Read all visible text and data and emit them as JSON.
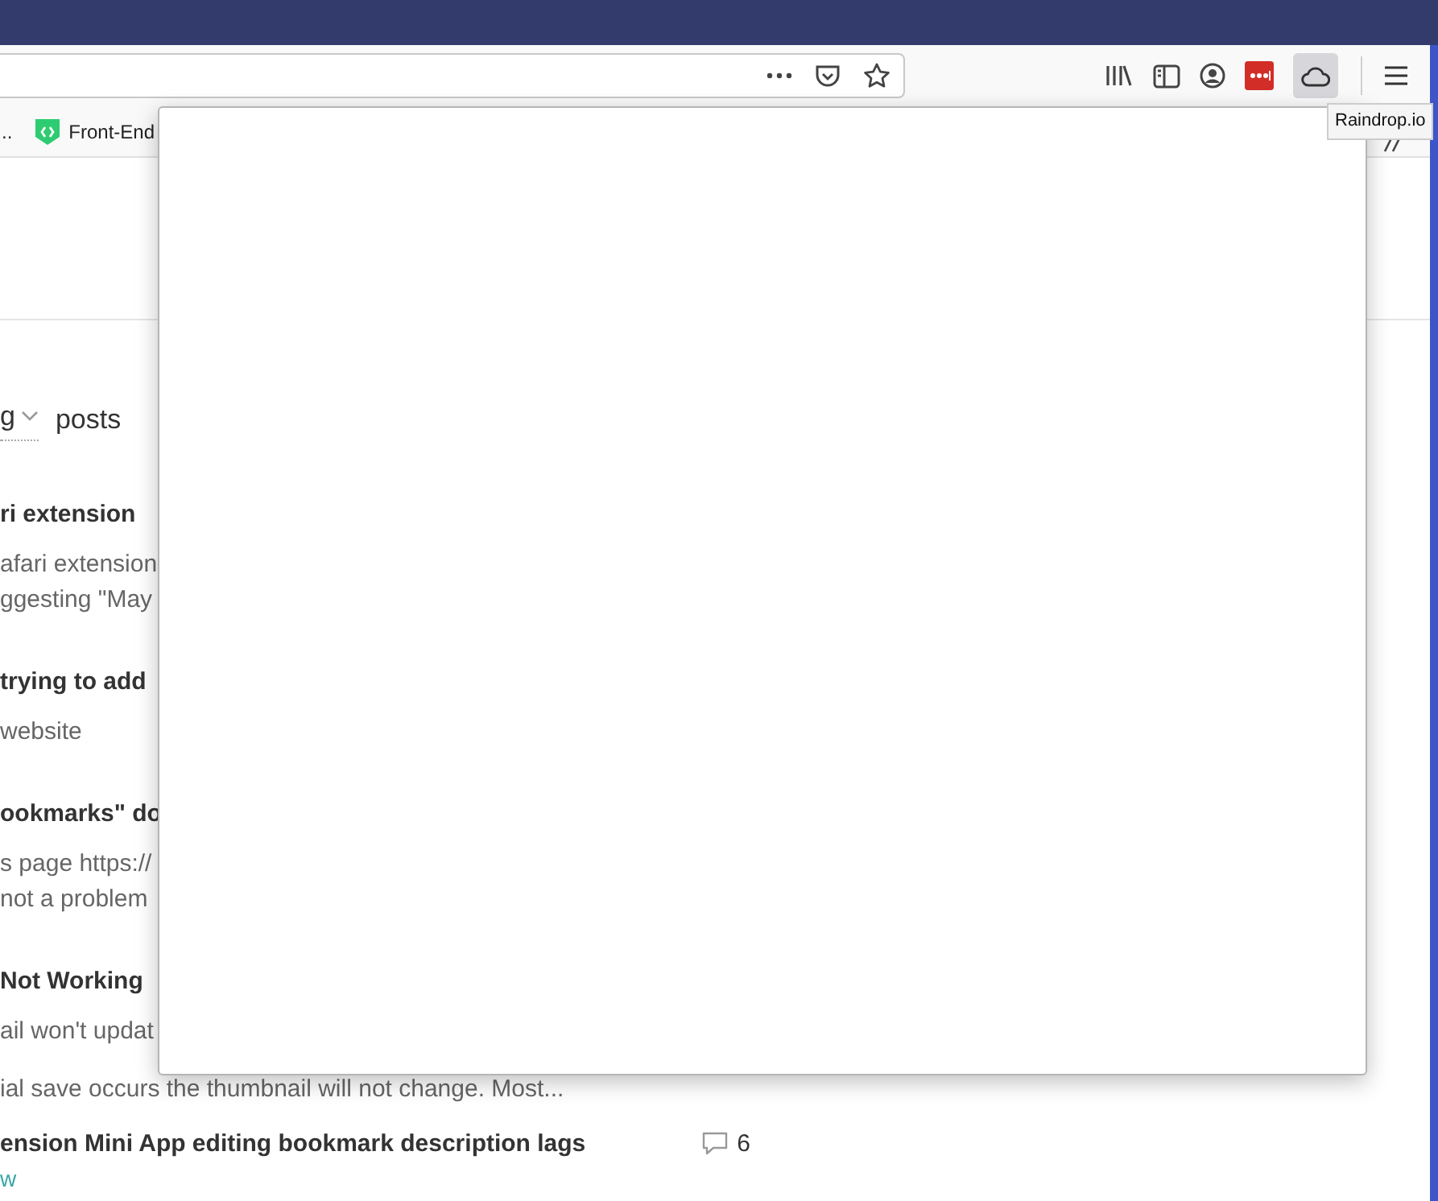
{
  "toolbar": {
    "raindrop_button": {
      "pressed": true
    },
    "tooltip": "Raindrop.io"
  },
  "bookmarks": [
    {
      "label": ".."
    },
    {
      "label": "Front-End"
    }
  ],
  "filter": {
    "value": "g",
    "label": "posts"
  },
  "posts": [
    {
      "title": "ri extension",
      "lines": [
        "afari extension",
        "ggesting \"May"
      ]
    },
    {
      "title": "trying to add",
      "lines": [
        "website"
      ]
    },
    {
      "title": "ookmarks\" do",
      "lines": [
        "s page https://",
        "not a problem"
      ]
    },
    {
      "title": "Not Working",
      "lines": [
        "ail won't updat",
        "ial save occurs the thumbnail will not change. Most..."
      ]
    },
    {
      "title": "ension Mini App editing bookmark description lags",
      "comments": "6",
      "lines": [
        "w"
      ]
    }
  ]
}
